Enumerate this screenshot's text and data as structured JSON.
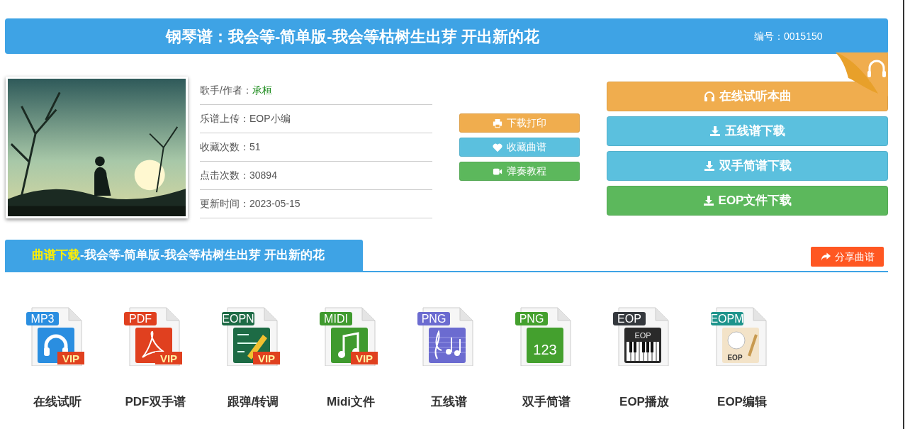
{
  "header": {
    "title": "钢琴谱：我会等-简单版-我会等枯树生出芽 开出新的花",
    "code": "编号：0015150"
  },
  "info": [
    {
      "label": "歌手/作者：",
      "value": "承桓",
      "link": true
    },
    {
      "label": "乐谱上传：",
      "value": "EOP小编",
      "link": false
    },
    {
      "label": "收藏次数：",
      "value": "51",
      "link": false
    },
    {
      "label": "点击次数：",
      "value": "30894",
      "link": false
    },
    {
      "label": "更新时间：",
      "value": "2023-05-15",
      "link": false
    }
  ],
  "small_buttons": [
    {
      "label": "下载打印"
    },
    {
      "label": "收藏曲谱"
    },
    {
      "label": "弹奏教程"
    }
  ],
  "big_buttons": [
    {
      "label": "在线试听本曲"
    },
    {
      "label": "五线谱下载"
    },
    {
      "label": "双手简谱下载"
    },
    {
      "label": "EOP文件下载"
    }
  ],
  "section": {
    "highlight": "曲谱下载",
    "title": "-我会等-简单版-我会等枯树生出芽 开出新的花",
    "share": "分享曲谱"
  },
  "files": [
    {
      "kind": "headphones",
      "tag": "MP3",
      "badge": "VIP",
      "label": "在线试听"
    },
    {
      "kind": "pdf",
      "tag": "PDF",
      "badge": "VIP",
      "label": "PDF双手谱"
    },
    {
      "kind": "pencil",
      "tag": "EOPN",
      "badge": "VIP",
      "label": "跟弹/转调"
    },
    {
      "kind": "note",
      "tag": "MIDI",
      "badge": "VIP",
      "label": "Midi文件"
    },
    {
      "kind": "staff",
      "tag": "PNG",
      "label": "五线谱"
    },
    {
      "kind": "numbers",
      "tag": "PNG",
      "art_text": "123",
      "label": "双手简谱"
    },
    {
      "kind": "piano",
      "tag": "EOP",
      "art_text": "EOP",
      "label": "EOP播放"
    },
    {
      "kind": "portrait",
      "tag": "EOPM",
      "art_text": "EOP",
      "label": "EOP编辑"
    }
  ]
}
